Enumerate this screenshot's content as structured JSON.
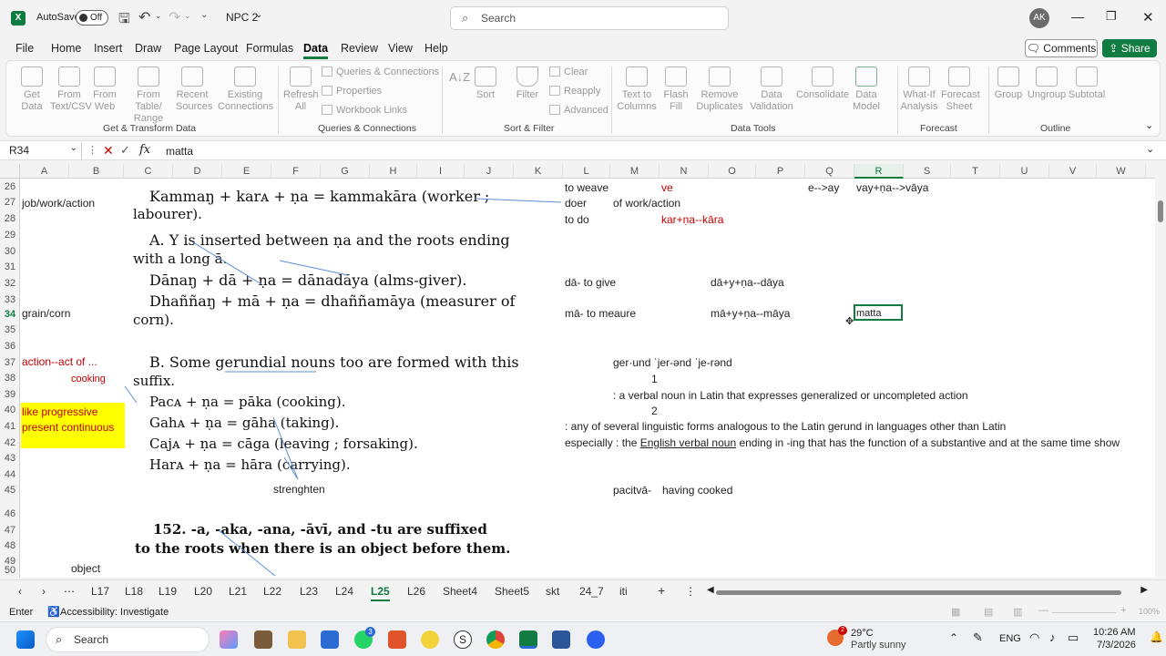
{
  "title": {
    "autosave": "AutoSave",
    "toggle": "Off",
    "filename": "NPC 2",
    "search": "Search",
    "avatar": "AK"
  },
  "menu": [
    "File",
    "Home",
    "Insert",
    "Draw",
    "Page Layout",
    "Formulas",
    "Data",
    "Review",
    "View",
    "Help"
  ],
  "comments": "Comments",
  "share": "Share",
  "ribbon": {
    "get_data": "Get Data",
    "from_text": "From Text/CSV",
    "from_web": "From Web",
    "from_table": "From Table/ Range",
    "recent": "Recent Sources",
    "existing": "Existing Connections",
    "refresh": "Refresh All",
    "queries": "Queries & Connections",
    "properties": "Properties",
    "workbook_links": "Workbook Links",
    "sort_az": "A↓Z",
    "sort": "Sort",
    "filter": "Filter",
    "clear": "Clear",
    "reapply": "Reapply",
    "advanced": "Advanced",
    "text_cols": "Text to Columns",
    "flash": "Flash Fill",
    "remove_dup": "Remove Duplicates",
    "validation": "Data Validation",
    "consolidate": "Consolidate",
    "data_model": "Data Model",
    "whatif": "What-If Analysis",
    "forecast_sheet": "Forecast Sheet",
    "group": "Group",
    "ungroup": "Ungroup",
    "subtotal": "Subtotal",
    "g1": "Get & Transform Data",
    "g2": "Queries & Connections",
    "g3": "Sort & Filter",
    "g4": "Data Tools",
    "g5": "Forecast",
    "g6": "Outline"
  },
  "formula": {
    "namebox": "R34",
    "fx": "fx",
    "value": "matta"
  },
  "columns": [
    "A",
    "B",
    "C",
    "D",
    "E",
    "F",
    "G",
    "H",
    "I",
    "J",
    "K",
    "L",
    "M",
    "N",
    "O",
    "P",
    "Q",
    "R",
    "S",
    "T",
    "U",
    "V",
    "W"
  ],
  "rows": [
    "26",
    "27",
    "28",
    "29",
    "30",
    "31",
    "32",
    "33",
    "34",
    "35",
    "36",
    "37",
    "38",
    "39",
    "40",
    "41",
    "42",
    "43",
    "44",
    "45",
    "46",
    "47",
    "48",
    "49",
    "50"
  ],
  "cells": {
    "a27": "job/work/action",
    "a34": "grain/corn",
    "a37": "action--act of ...",
    "b38": "cooking",
    "a40": "like progressive present continuous",
    "b50": "object",
    "l26": "to weave",
    "n26": "ve",
    "q26": "e-->ay",
    "r26": "vay+ṇa-->vāya",
    "l27": "doer",
    "m27": "of work/action",
    "l28": "to do",
    "n28": "kar+ṇa--kāra",
    "l32": "dā- to give",
    "o32": "dā+y+ṇa--dāya",
    "l34": "mā- to meaure",
    "o34": "mā+y+ṇa--māya",
    "r34": "matta",
    "m37": "ger·und ˈjer-ənd ˈje-rənd",
    "m38": "1",
    "m39": ": a verbal noun in Latin that expresses generalized or uncompleted action",
    "m40": "2",
    "l41": ": any of several linguistic forms analogous to the Latin gerund in languages other than Latin",
    "l42a": "especially : the ",
    "l42b": "English verbal noun",
    "l42c": " ending in -ing that has the function of a substantive and at the same time show",
    "m45a": "pacitvā-",
    "m45b": "having cooked",
    "e45": "strenghten"
  },
  "book": [
    "Kammaŋ + karᴀ + ṇa = kammakāra (worker ;",
    "labourer).",
    "A. Y is inserted between ṇa and the roots ending",
    "with a long ā.",
    "Dānaŋ + dā + ṇa = dānadāya (alms-giver).",
    "Dhaññaŋ + mā + ṇa = dhaññamāya (measurer of",
    "corn).",
    "B. Some gerundial nouns too are formed with this",
    "suffix.",
    "Pacᴀ + ṇa = pāka (cooking).",
    "Gahᴀ + ṇa = gāha (taking).",
    "Cajᴀ + ṇa = cāga (leaving ; forsaking).",
    "Harᴀ + ṇa = hāra (carrying).",
    "152. -a, -aka, -ana, -āvī, and -tu are suffixed",
    "to the roots when there is an object before them."
  ],
  "tabs": [
    "L17",
    "L18",
    "L19",
    "L20",
    "L21",
    "L22",
    "L23",
    "L24",
    "L25",
    "L26",
    "Sheet4",
    "Sheet5",
    "skt",
    "24_7",
    "iti"
  ],
  "status": {
    "mode": "Enter",
    "accessibility": "Accessibility: Investigate",
    "zoom": "100%"
  },
  "taskbar": {
    "search": "Search",
    "temp": "29°C",
    "weather": "Partly sunny",
    "lang": "ENG",
    "time": "10:26 AM",
    "date": "7/3/2026",
    "badge": "2",
    "wa_badge": "3"
  },
  "colors": {
    "excel_green": "#107c41",
    "yellow": "#ffff00",
    "red": "#c00000"
  }
}
